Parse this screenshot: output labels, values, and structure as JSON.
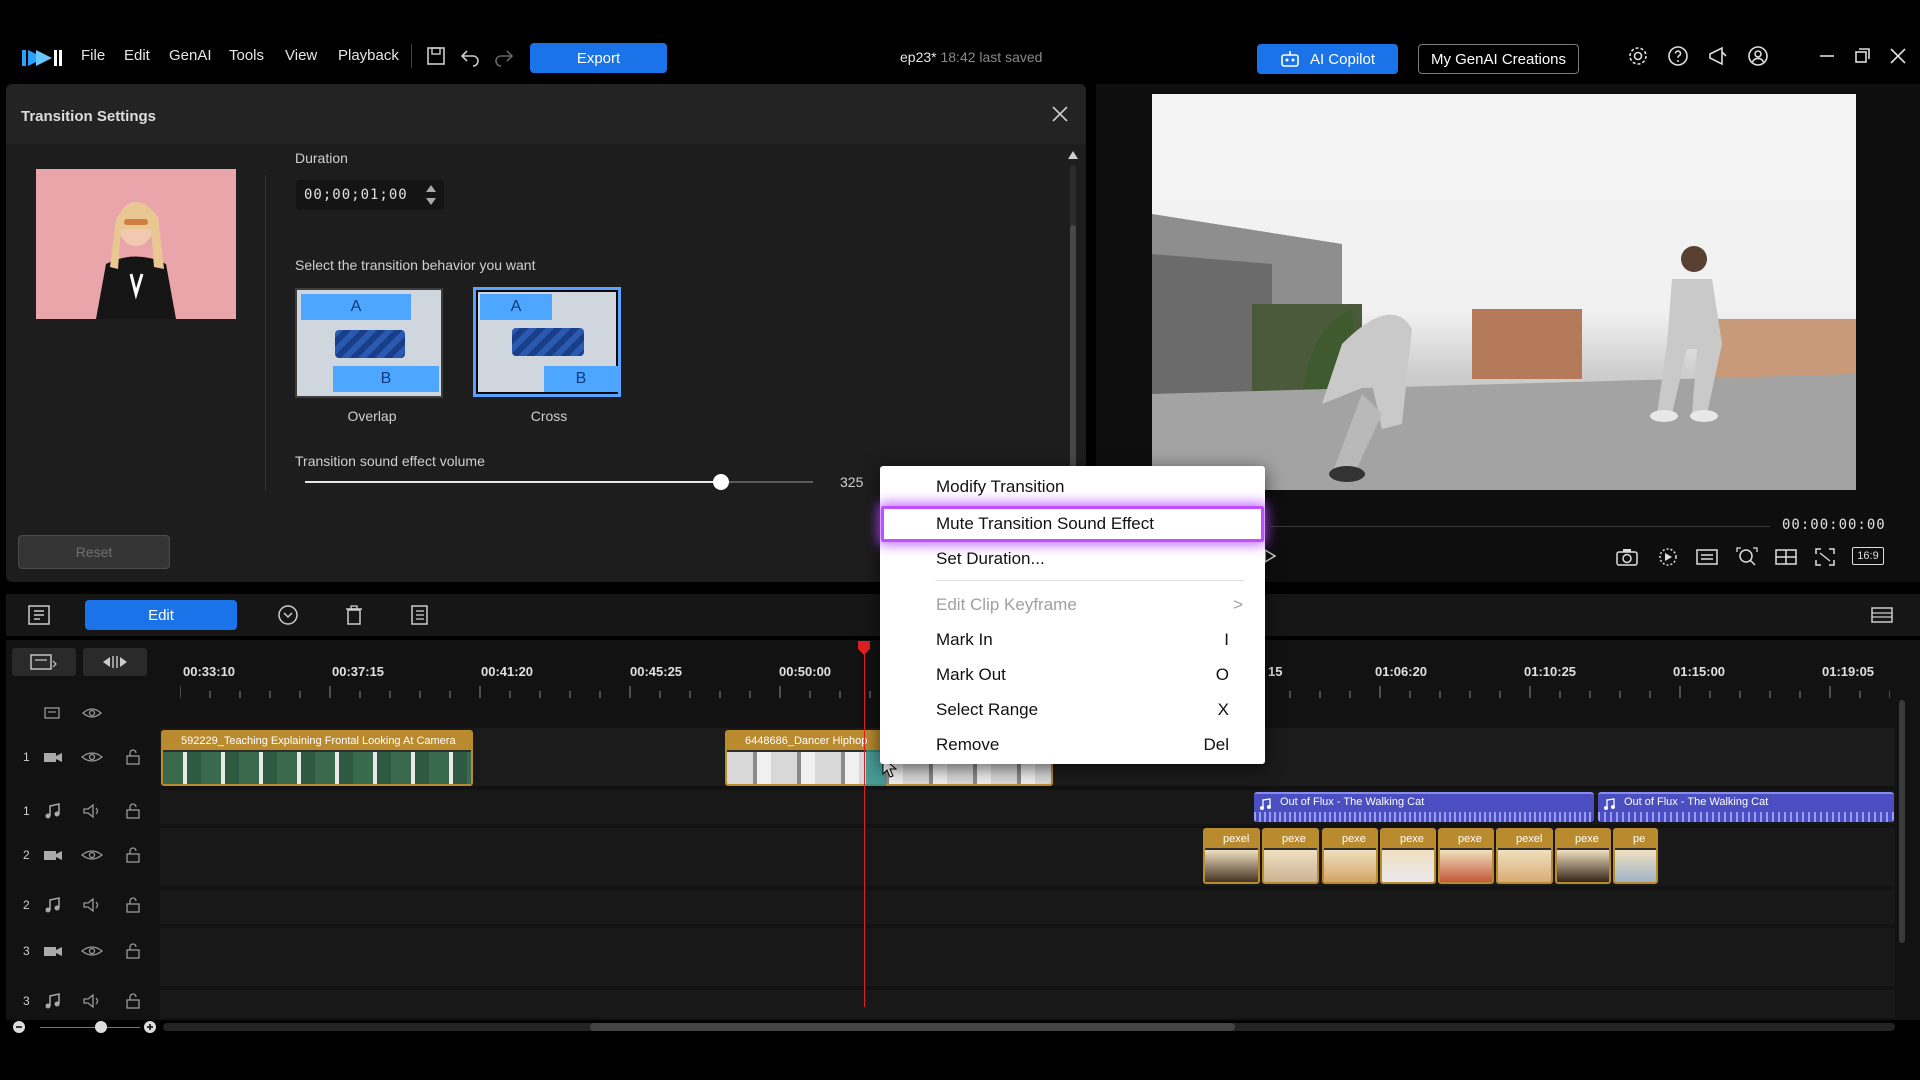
{
  "menubar": {
    "items": [
      "File",
      "Edit",
      "GenAI",
      "Tools",
      "View",
      "Playback"
    ],
    "export_label": "Export",
    "project_name": "ep23*",
    "last_saved": "18:42 last saved",
    "ai_copilot_label": "AI Copilot",
    "genai_creations_label": "My GenAI Creations"
  },
  "transition": {
    "title": "Transition Settings",
    "duration_label": "Duration",
    "duration_value": "00;00;01;00",
    "behavior_prompt": "Select the transition behavior you want",
    "behaviors": [
      {
        "label": "Overlap",
        "a": "A",
        "b": "B",
        "selected": false
      },
      {
        "label": "Cross",
        "a": "A",
        "b": "B",
        "selected": true
      }
    ],
    "volume_label": "Transition sound effect volume",
    "volume_value": "325",
    "volume_level": 0.82,
    "reset_label": "Reset"
  },
  "preview": {
    "timecode": "00:00:00:00",
    "aspect_label": "16:9"
  },
  "timeline": {
    "edit_label": "Edit",
    "ruler": [
      "00:33:10",
      "00:37:15",
      "00:41:20",
      "00:45:25",
      "00:50:00",
      "15",
      "01:06:20",
      "01:10:25",
      "01:15:00",
      "01:19:05"
    ],
    "track_numbers": [
      "1",
      "1",
      "2",
      "2",
      "3",
      "3"
    ],
    "clips": {
      "video1_a": "592229_Teaching Explaining Frontal Looking At Camera",
      "video1_b": "6448686_Dancer Hiphop",
      "audio_a": "Out of Flux - The Walking Cat",
      "audio_b": "Out of Flux - The Walking Cat",
      "video2": [
        "pexels",
        "pexels",
        "pexels",
        "pexels",
        "pexels",
        "pexels",
        "pexels",
        "pexels"
      ],
      "video2_labels": [
        "pexel",
        "pexe",
        "pexe",
        "pexe",
        "pexe",
        "pexel",
        "pexe",
        "pe"
      ]
    }
  },
  "context_menu": {
    "items": [
      {
        "label": "Modify Transition",
        "shortcut": "",
        "disabled": false
      },
      {
        "label": "Mute Transition Sound Effect",
        "shortcut": "",
        "disabled": false
      },
      {
        "label": "Set Duration...",
        "shortcut": "",
        "disabled": false
      },
      {
        "label": "Edit Clip Keyframe",
        "shortcut": ">",
        "disabled": true
      },
      {
        "label": "Mark In",
        "shortcut": "I",
        "disabled": false
      },
      {
        "label": "Mark Out",
        "shortcut": "O",
        "disabled": false
      },
      {
        "label": "Select Range",
        "shortcut": "X",
        "disabled": false
      },
      {
        "label": "Remove",
        "shortcut": "Del",
        "disabled": false
      }
    ]
  },
  "colors": {
    "accent": "#1a73e8",
    "highlight": "#c050ff",
    "playhead": "#e02020",
    "video_clip": "#b98a2e",
    "audio_clip": "#4a4ec0"
  }
}
